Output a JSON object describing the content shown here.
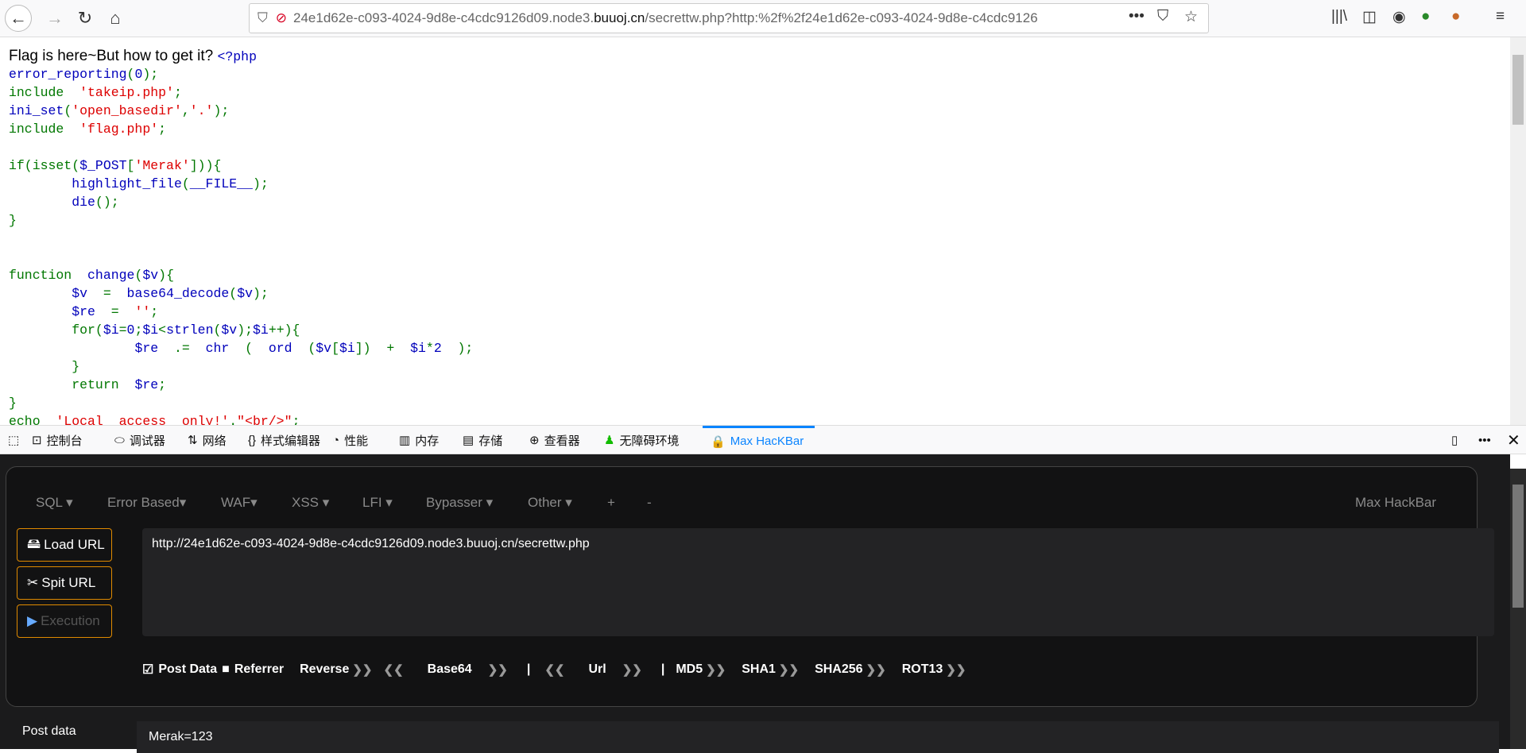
{
  "browser": {
    "url_prefix": "24e1d62e-c093-4024-9d8e-c4cdc9126d09.node3.",
    "url_domain": "buuoj.cn",
    "url_rest": "/secrettw.php?http:%2f%2f24e1d62e-c093-4024-9d8e-c4cdc9126"
  },
  "page": {
    "title": "Flag is here~But how to get it? ",
    "code": [
      [
        [
          "<?php",
          "b"
        ]
      ],
      [
        [
          "error_reporting",
          "b"
        ],
        [
          "(",
          "g"
        ],
        [
          "0",
          "b"
        ],
        [
          ");",
          "g"
        ]
      ],
      [
        [
          "include  ",
          "g"
        ],
        [
          "'takeip.php'",
          "r"
        ],
        [
          ";",
          "g"
        ]
      ],
      [
        [
          "ini_set",
          "b"
        ],
        [
          "(",
          "g"
        ],
        [
          "'open_basedir'",
          "r"
        ],
        [
          ",",
          "g"
        ],
        [
          "'.'",
          "r"
        ],
        [
          ");",
          "g"
        ]
      ],
      [
        [
          "include  ",
          "g"
        ],
        [
          "'flag.php'",
          "r"
        ],
        [
          ";",
          "g"
        ]
      ],
      [],
      [
        [
          "if(isset(",
          "g"
        ],
        [
          "$_POST",
          "b"
        ],
        [
          "[",
          "g"
        ],
        [
          "'Merak'",
          "r"
        ],
        [
          "])){",
          "g"
        ]
      ],
      [
        [
          "        ",
          "g"
        ],
        [
          "highlight_file",
          "b"
        ],
        [
          "(",
          "g"
        ],
        [
          "__FILE__",
          "b"
        ],
        [
          ");",
          "g"
        ]
      ],
      [
        [
          "        ",
          "g"
        ],
        [
          "die",
          "b"
        ],
        [
          "();",
          "g"
        ]
      ],
      [
        [
          "}",
          "g"
        ]
      ],
      [],
      [],
      [
        [
          "function  ",
          "g"
        ],
        [
          "change",
          "b"
        ],
        [
          "(",
          "g"
        ],
        [
          "$v",
          "b"
        ],
        [
          "){",
          "g"
        ]
      ],
      [
        [
          "        ",
          "g"
        ],
        [
          "$v",
          "b"
        ],
        [
          "  =  ",
          "g"
        ],
        [
          "base64_decode",
          "b"
        ],
        [
          "(",
          "g"
        ],
        [
          "$v",
          "b"
        ],
        [
          ");",
          "g"
        ]
      ],
      [
        [
          "        ",
          "g"
        ],
        [
          "$re",
          "b"
        ],
        [
          "  =  ",
          "g"
        ],
        [
          "''",
          "r"
        ],
        [
          ";",
          "g"
        ]
      ],
      [
        [
          "        for(",
          "g"
        ],
        [
          "$i",
          "b"
        ],
        [
          "=",
          "g"
        ],
        [
          "0",
          "b"
        ],
        [
          ";",
          "g"
        ],
        [
          "$i",
          "b"
        ],
        [
          "<",
          "g"
        ],
        [
          "strlen",
          "b"
        ],
        [
          "(",
          "g"
        ],
        [
          "$v",
          "b"
        ],
        [
          ");",
          "g"
        ],
        [
          "$i",
          "b"
        ],
        [
          "++){",
          "g"
        ]
      ],
      [
        [
          "                ",
          "g"
        ],
        [
          "$re",
          "b"
        ],
        [
          "  .=  ",
          "g"
        ],
        [
          "chr",
          "b"
        ],
        [
          "  (  ",
          "g"
        ],
        [
          "ord",
          "b"
        ],
        [
          "  (",
          "g"
        ],
        [
          "$v",
          "b"
        ],
        [
          "[",
          "g"
        ],
        [
          "$i",
          "b"
        ],
        [
          "])  +  ",
          "g"
        ],
        [
          "$i",
          "b"
        ],
        [
          "*",
          "g"
        ],
        [
          "2",
          "b"
        ],
        [
          "  );",
          "g"
        ]
      ],
      [
        [
          "        }",
          "g"
        ]
      ],
      [
        [
          "        return  ",
          "g"
        ],
        [
          "$re",
          "b"
        ],
        [
          ";",
          "g"
        ]
      ],
      [
        [
          "}",
          "g"
        ]
      ],
      [
        [
          "echo  ",
          "g"
        ],
        [
          "'Local  access  only!'",
          "r"
        ],
        [
          ".",
          "g"
        ],
        [
          "\"<br/>\"",
          "r"
        ],
        [
          ";",
          "g"
        ]
      ]
    ]
  },
  "devtools": {
    "tabs": [
      "控制台",
      "调试器",
      "网络",
      "样式编辑器",
      "性能",
      "内存",
      "存储",
      "查看器",
      "无障碍环境",
      "Max HacKBar"
    ],
    "selected": "Max HacKBar"
  },
  "hackbar": {
    "menu": [
      "SQL ▾",
      "Error Based▾",
      "WAF▾",
      "XSS ▾",
      "LFI ▾",
      "Bypasser ▾",
      "Other ▾",
      "+",
      "-"
    ],
    "brand": "Max HackBar",
    "buttons": [
      "Load URL",
      "Spit URL",
      "Execution"
    ],
    "url": "http://24e1d62e-c093-4024-9d8e-c4cdc9126d09.node3.buuoj.cn/secrettw.php",
    "post_data_label": "Post Data",
    "post_data_checked": true,
    "referrer_label": "Referrer",
    "referrer_checked": false,
    "encoders": [
      "Reverse",
      "Base64",
      "Url",
      "MD5",
      "SHA1",
      "SHA256",
      "ROT13"
    ],
    "post_label": "Post data",
    "post_value": "Merak=123"
  }
}
